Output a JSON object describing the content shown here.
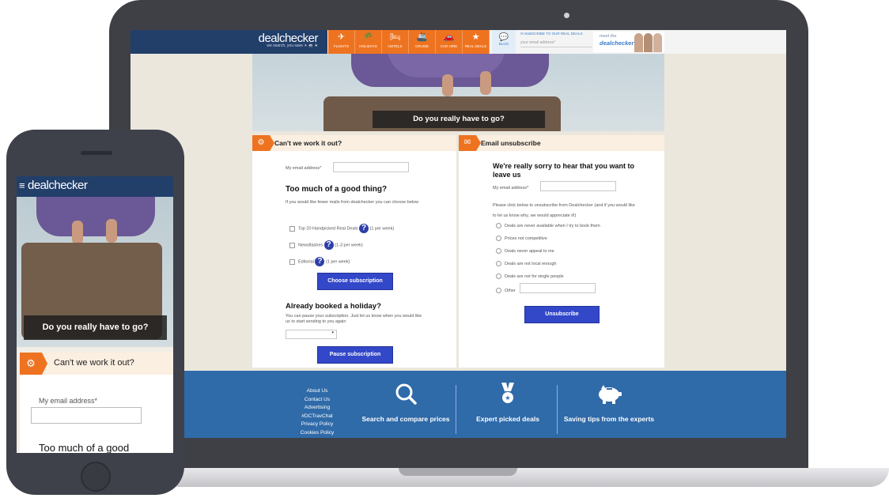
{
  "desktop": {
    "logo": "dealchecker",
    "tagline": "we search, you save ✈ 🚢 ★",
    "nav": [
      {
        "label": "FLIGHTS",
        "icon": "plane-icon",
        "glyph": "✈"
      },
      {
        "label": "HOLIDAYS",
        "icon": "palm-tree-icon",
        "glyph": "🌴"
      },
      {
        "label": "HOTELS",
        "icon": "bed-icon",
        "glyph": "🛏"
      },
      {
        "label": "CRUISE",
        "icon": "ship-icon",
        "glyph": "🚢"
      },
      {
        "label": "CAR HIRE",
        "icon": "car-icon",
        "glyph": "🚗"
      },
      {
        "label": "REAL DEALS",
        "icon": "star-icon",
        "glyph": "★"
      }
    ],
    "blog": {
      "label": "BLOG",
      "glyph": "💬"
    },
    "subscribe": {
      "label": "SUBSCRIBE TO OUR REAL DEALS",
      "placeholder": "your email address*"
    },
    "meet": {
      "line1": "meet the",
      "line2": "dealcheckers"
    },
    "hero_caption": "Do you really have to go?",
    "left_panel": {
      "title": "Can't we work it out?",
      "email_label": "My email address*",
      "heading": "Too much of a good thing?",
      "intro": "If you would like fewer mails from dealchecker you can choose below",
      "options": [
        {
          "label": "Top 20 Handpicked Real Deals",
          "freq": "(1 per week)"
        },
        {
          "label": "Newsflashes",
          "freq": "(1-3 per week)"
        },
        {
          "label": "Editorial",
          "freq": "(1 per week)"
        }
      ],
      "choose_button": "Choose subscription",
      "booked_heading": "Already booked a holiday?",
      "booked_text": "You can pause your subscription. Just let us know when you would like us to start sending to you again",
      "pause_button": "Pause subscription"
    },
    "right_panel": {
      "title": "Email unsubscribe",
      "heading": "We're really sorry to hear that you want to leave us",
      "email_label": "My email address*",
      "intro": "Please click below to unsubscribe from Dealchecker (and if you would like to let us know why, we would appreciate it!)",
      "reasons": [
        "Deals are never available when I try to book them",
        "Prices not competitive",
        "Deals never appeal to me",
        "Deals are not local enough",
        "Deals are not for single people",
        "Other"
      ],
      "unsubscribe_button": "Unsubscribe"
    },
    "footer": {
      "links": [
        "About Us",
        "Contact Us",
        "Advertising",
        "#DCTravChat",
        "Privacy Policy",
        "Cookies Policy"
      ],
      "features": [
        {
          "icon": "search-icon",
          "text": "Search and compare prices"
        },
        {
          "icon": "medal-icon",
          "text": "Expert picked deals"
        },
        {
          "icon": "piggy-bank-icon",
          "text": "Saving tips from the experts"
        }
      ]
    }
  },
  "mobile": {
    "logo": "dealchecker",
    "hero_caption": "Do you really have to go?",
    "panel_title": "Can't we work it out?",
    "email_label": "My email address*",
    "heading": "Too much of a good"
  },
  "colors": {
    "navy": "#223f6a",
    "orange": "#ee7320",
    "button_blue": "#3347c9",
    "footer_blue": "#2f6aa9"
  }
}
